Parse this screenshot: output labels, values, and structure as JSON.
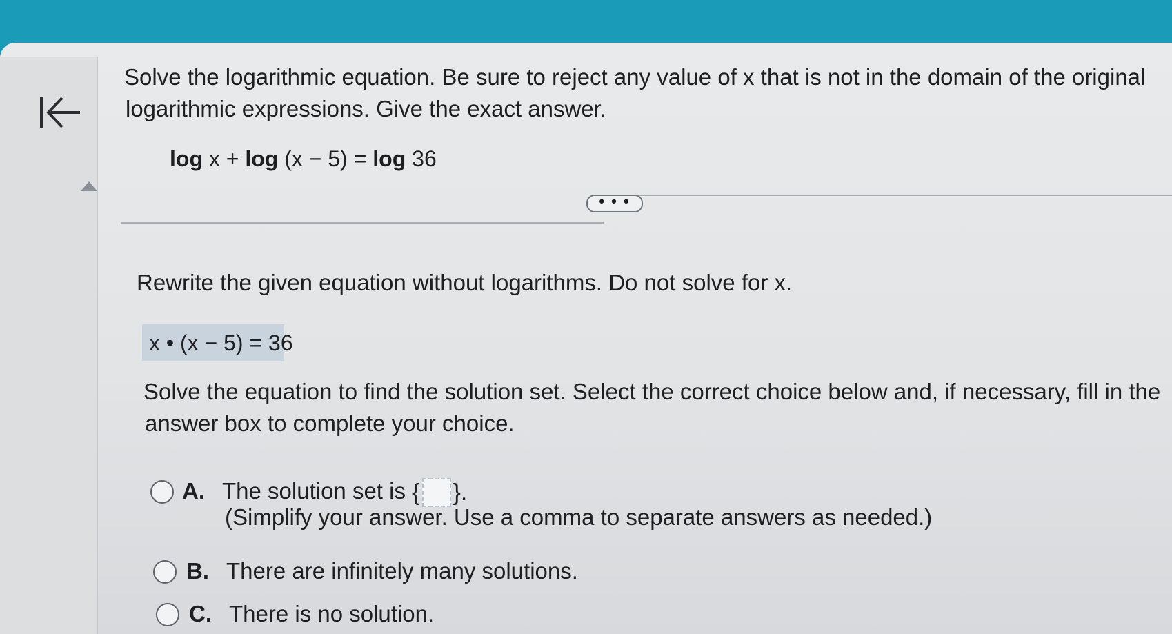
{
  "question": {
    "prompt_line1": "Solve the logarithmic equation. Be sure to reject any value of x that is not in the domain of the original",
    "prompt_line2": "logarithmic expressions. Give the exact answer.",
    "equation": {
      "log1": "log",
      "var1": "x +",
      "log2": "log",
      "arg2": "(x − 5) =",
      "log3": "log",
      "arg3": "36"
    }
  },
  "more_button": "• • •",
  "step1": {
    "title": "Rewrite the given equation without logarithms. Do not solve for x.",
    "answer": "x • (x − 5) = 36"
  },
  "step2": {
    "instruction_line1": "Solve the equation to find the solution set. Select the correct choice below and, if necessary, fill in the",
    "instruction_line2": "answer box to complete your choice.",
    "choices": [
      {
        "letter": "A.",
        "text": "The solution set is",
        "open_brace": "{",
        "close_brace": "}.",
        "hint": "(Simplify your answer.  Use a comma to separate answers as needed.)"
      },
      {
        "letter": "B.",
        "text": "There are infinitely many solutions."
      },
      {
        "letter": "C.",
        "text": "There is no solution."
      }
    ]
  }
}
